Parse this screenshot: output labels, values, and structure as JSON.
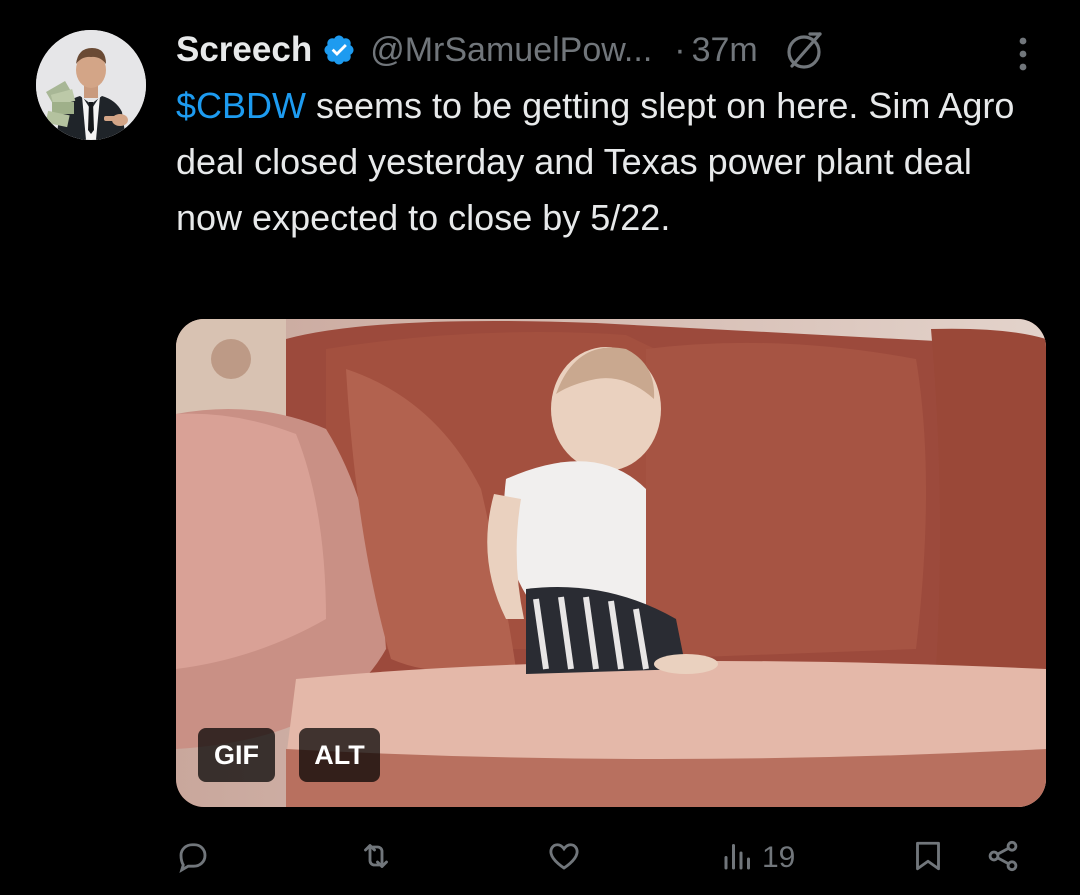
{
  "tweet": {
    "display_name": "Screech",
    "verified": true,
    "handle": "@MrSamuelPow...",
    "separator": "·",
    "time": "37m",
    "cashtag": "$CBDW",
    "text_rest": " seems to be getting slept on here. Sim Agro deal closed yesterday and Texas power plant deal now expected to close by 5/22.",
    "media": {
      "type": "gif",
      "gif_badge": "GIF",
      "alt_badge": "ALT"
    },
    "actions": {
      "reply_icon": "reply-icon",
      "retweet_icon": "retweet-icon",
      "like_icon": "heart-icon",
      "views_icon": "views-icon",
      "views_count": "19",
      "bookmark_icon": "bookmark-icon",
      "share_icon": "share-icon"
    }
  },
  "colors": {
    "background": "#000000",
    "text": "#e7e9ea",
    "secondary": "#71767b",
    "accent": "#1d9bf0"
  }
}
